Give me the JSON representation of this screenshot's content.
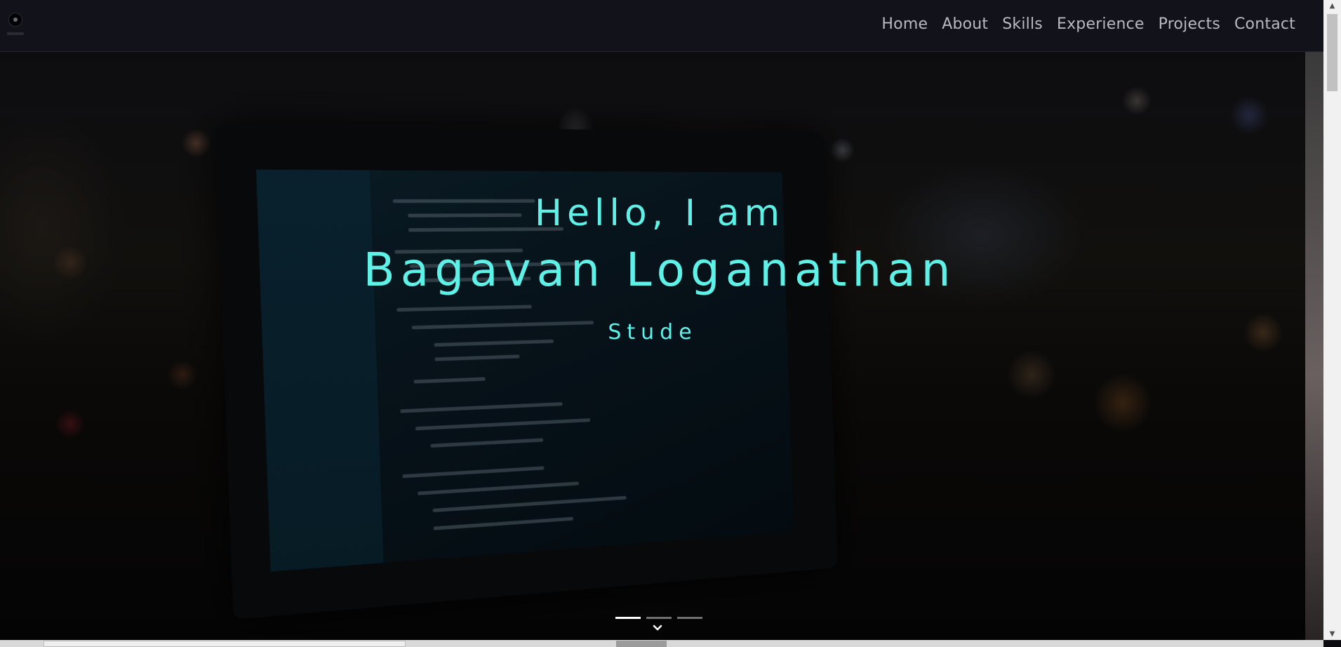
{
  "navbar": {
    "links": [
      {
        "label": "Home"
      },
      {
        "label": "About"
      },
      {
        "label": "Skills"
      },
      {
        "label": "Experience"
      },
      {
        "label": "Projects"
      },
      {
        "label": "Contact"
      }
    ]
  },
  "hero": {
    "greeting": "Hello, I am",
    "name": "Bagavan Loganathan",
    "role": "Stude",
    "carousel": {
      "slides": 3,
      "active_slide": 1
    },
    "scroll_icon": "chevron-down-icon"
  },
  "colors": {
    "accent": "#5ef1e8",
    "navbar_bg": "#12121b",
    "nav_text": "#b9b9c1"
  }
}
